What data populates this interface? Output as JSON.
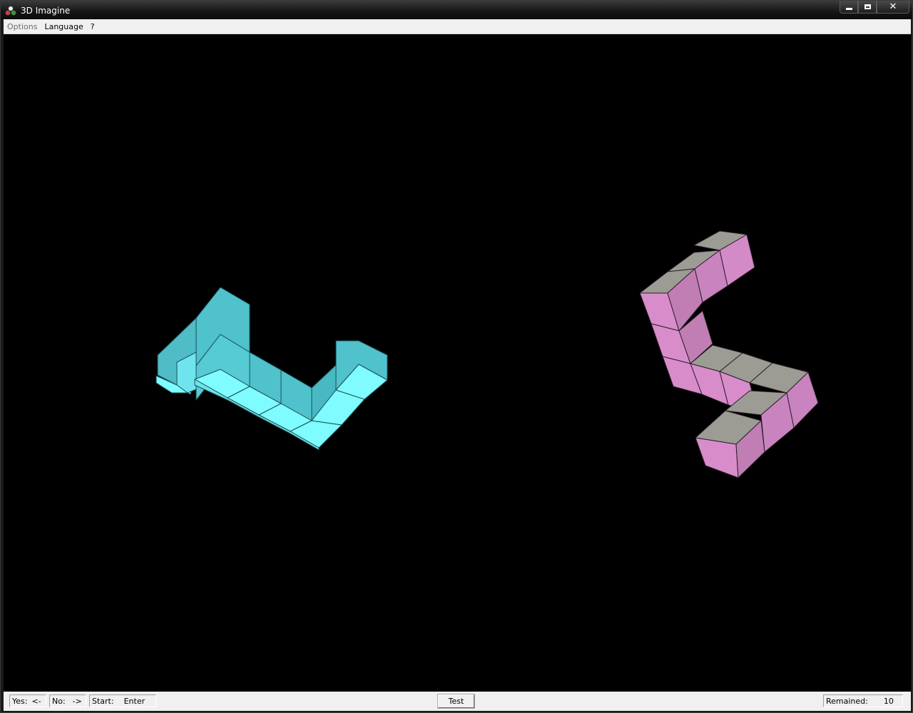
{
  "window": {
    "title": "3D Imagine",
    "icon": "app-icon",
    "buttons": [
      "minimize-icon",
      "maximize-icon",
      "close-icon"
    ]
  },
  "menu": {
    "items": [
      {
        "label": "Options",
        "enabled": false
      },
      {
        "label": "Language",
        "enabled": true
      },
      {
        "label": "?",
        "enabled": true
      }
    ]
  },
  "scene": {
    "background": "#000000",
    "shapes": [
      {
        "name": "left-shape",
        "color_top": "#7ffcff",
        "color_side": "#4fc2cc",
        "cube_count": 10
      },
      {
        "name": "right-shape",
        "color_top": "#9c9c94",
        "color_front": "#d98cca",
        "color_side": "#c07eb4",
        "cube_count": 10
      }
    ]
  },
  "status": {
    "yes_label": "Yes:",
    "yes_key": "<-",
    "no_label": "No:",
    "no_key": "->",
    "start_label": "Start:",
    "start_key": "Enter",
    "test_button": "Test",
    "remained_label": "Remained:",
    "remained_value": "10"
  }
}
